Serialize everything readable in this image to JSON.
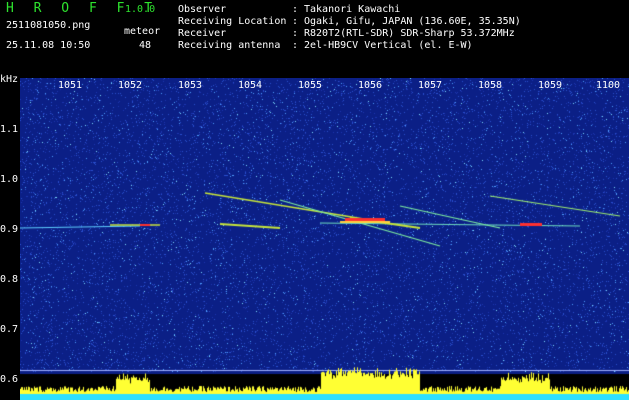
{
  "header": {
    "brand": "H R O F F T",
    "version": "1.0.0",
    "filename": "2511081050.png",
    "meteor_label": "meteor",
    "datetime": "25.11.08 10:50",
    "meteor_count": "48",
    "rows": [
      {
        "key": "Observer",
        "value": "Takanori Kawachi"
      },
      {
        "key": "Receiving Location",
        "value": "Ogaki, Gifu, JAPAN (136.60E, 35.35N)"
      },
      {
        "key": "Receiver",
        "value": "R820T2(RTL-SDR) SDR-Sharp 53.372MHz"
      },
      {
        "key": "Receiving antenna",
        "value": "2el-HB9CV Vertical (el. E-W)"
      }
    ],
    "separator": ":"
  },
  "axes": {
    "y_unit": "kHz",
    "y_ticks": [
      "1.1",
      "1.0",
      "0.9",
      "0.8",
      "0.7",
      "0.6"
    ],
    "x_ticks": [
      "1051",
      "1052",
      "1053",
      "1054",
      "1055",
      "1056",
      "1057",
      "1058",
      "1059",
      "1100"
    ]
  },
  "colors": {
    "header_green": "#2ee32e",
    "background_noise": "#0b1f86",
    "trace": "#c8e63a",
    "hot": "#ff3030",
    "histogram": "#ffff33",
    "baseline": "#2ee0ff"
  }
}
